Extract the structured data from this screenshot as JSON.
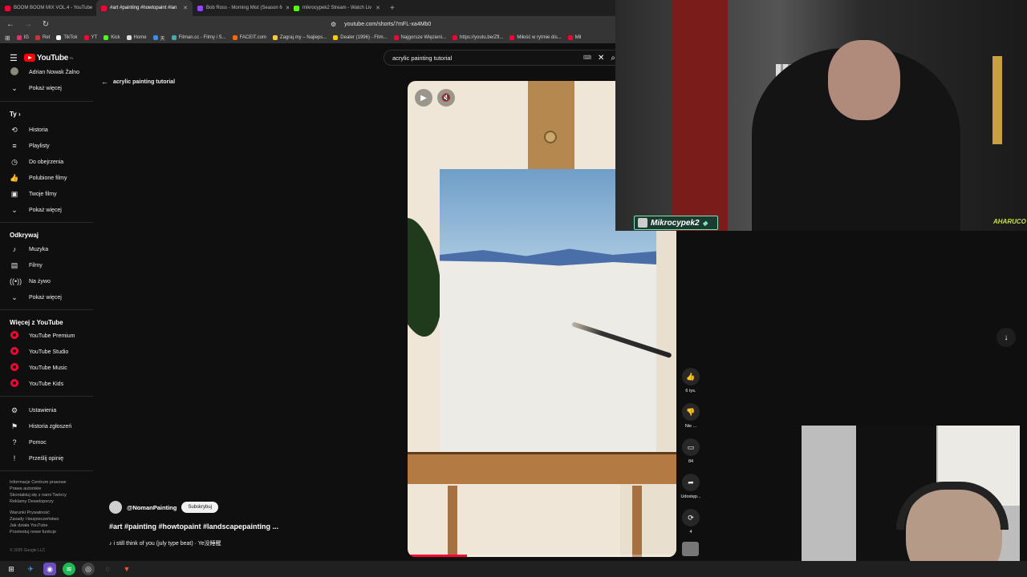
{
  "browser": {
    "tabs": [
      {
        "title": "BOOM BOOM MIX VOL.4 - YouTube",
        "color": "#ff0033"
      },
      {
        "title": "#art #painting #howtopaint #lan",
        "color": "#ff0033",
        "active": true
      },
      {
        "title": "Bob Ross - Morning Mist (Season 6",
        "color": "#9146ff"
      },
      {
        "title": "mikrocypek2 Stream - Watch Liv",
        "color": "#53fc18"
      }
    ],
    "url": "youtube.com/shorts/7mFL-xa4Mb0",
    "bookmarks": [
      "IG",
      "Ret",
      "TikTok",
      "YT",
      "Kick",
      "Home",
      "天",
      "Filman.cc - Filmy i S...",
      "FACEIT.com",
      "Zagraj.my – Najleps...",
      "Dealer (1996) - Film...",
      "Najgorsze Więzieni...",
      "https://youtu.be/Zfl...",
      "Miłość w rytmie dis...",
      "Mil"
    ]
  },
  "youtube": {
    "logo": "YouTube",
    "logo_region": "PL",
    "account_name": "Adrian Nowak Żalno",
    "show_more": "Pokaż więcej",
    "section_you": "Ty",
    "you_items": [
      "Historia",
      "Playlisty",
      "Do obejrzenia",
      "Polubione filmy",
      "Twoje filmy",
      "Pokaż więcej"
    ],
    "section_explore": "Odkrywaj",
    "explore_items": [
      "Muzyka",
      "Filmy",
      "Na żywo",
      "Pokaż więcej"
    ],
    "section_more": "Więcej z YouTube",
    "more_items": [
      "YouTube Premium",
      "YouTube Studio",
      "YouTube Music",
      "YouTube Kids"
    ],
    "settings_items": [
      "Ustawienia",
      "Historia zgłoszeń",
      "Pomoc",
      "Prześlij opinię"
    ],
    "footer_lines": [
      "Informacje  Centrum prasowe",
      "Prawa autorskie",
      "Skontaktuj się z nami  Twórcy",
      "Reklamy  Deweloperzy",
      "",
      "Warunki  Prywatność",
      "Zasady i bezpieczeństwo",
      "Jak działa YouTube",
      "Przetestuj nowe funkcje"
    ],
    "copyright": "© 2025 Google LLC",
    "search_query": "acrylic painting tutorial",
    "back_label": "acrylic painting tutorial",
    "short": {
      "channel": "@NomanPainting",
      "subscribe": "Subskrybuj",
      "title": "#art #painting #howtopaint #landscapepainting ...",
      "music": "♪ i still think of you  (july type beat)  · Ye没睡醒",
      "progress": 0.22
    },
    "actions": [
      {
        "icon": "like-icon",
        "label": "6 tys."
      },
      {
        "icon": "dislike-icon",
        "label": "Nie ..."
      },
      {
        "icon": "comment-icon",
        "label": "84"
      },
      {
        "icon": "share-icon",
        "label": "Udostęp..."
      },
      {
        "icon": "remix-icon",
        "label": "4"
      }
    ]
  },
  "stream": {
    "streamer_name": "Mikrocypek2",
    "brand": "AHARUCO"
  }
}
